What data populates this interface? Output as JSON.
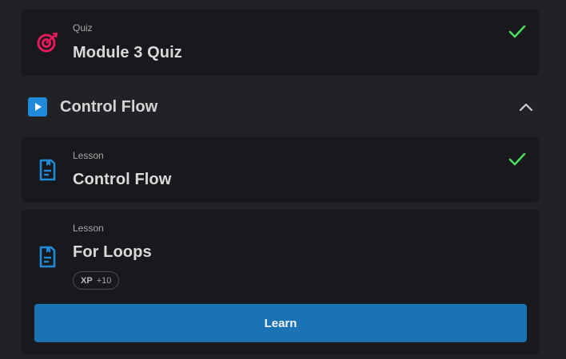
{
  "quiz": {
    "kind": "Quiz",
    "title": "Module 3 Quiz",
    "icon": "target-icon",
    "completed": true
  },
  "section": {
    "title": "Control Flow",
    "icon": "play-icon",
    "expanded": true
  },
  "lessons": [
    {
      "kind": "Lesson",
      "title": "Control Flow",
      "icon": "lesson-doc-icon",
      "completed": true
    },
    {
      "kind": "Lesson",
      "title": "For Loops",
      "icon": "lesson-doc-icon",
      "xp_label": "XP",
      "xp_value": "+10",
      "button_label": "Learn"
    }
  ],
  "colors": {
    "accent": "#1b73b4",
    "check": "#4cd964",
    "quiz_icon": "#e6195d",
    "lesson_icon": "#1f8ad8",
    "card_bg": "#18191c",
    "page_bg": "#212226"
  }
}
